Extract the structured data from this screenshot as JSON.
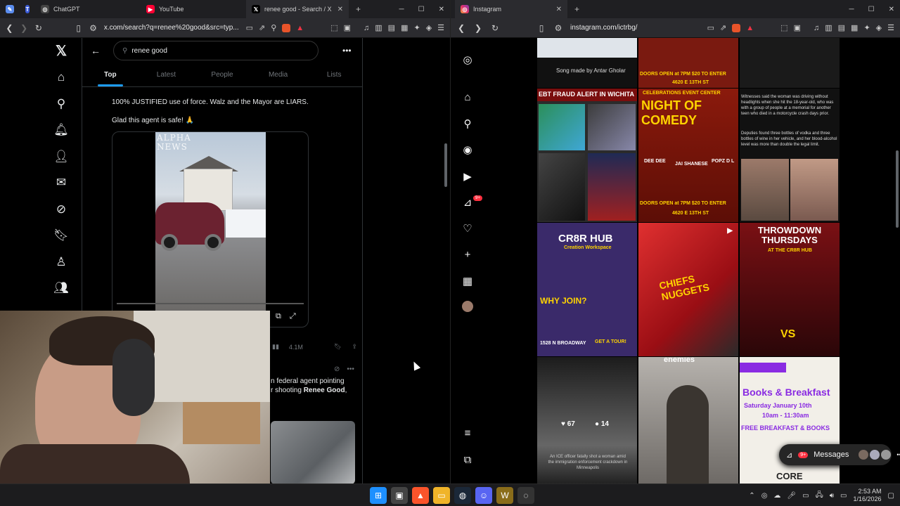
{
  "left_browser": {
    "tabs": [
      {
        "title": "ChatGPT",
        "active": false
      },
      {
        "title": "YouTube",
        "active": false
      },
      {
        "title": "renee good - Search / X",
        "active": true
      }
    ],
    "url": "x.com/search?q=renee%20good&src=typ..."
  },
  "x": {
    "search_value": "renee good",
    "tabs": [
      "Top",
      "Latest",
      "People",
      "Media",
      "Lists"
    ],
    "active_tab": "Top",
    "tweet1": {
      "text": "100% JUSTIFIED use of force. Walz and the Mayor are LIARS.",
      "text2": "Glad this agent is safe! 🙏",
      "watermark": "ALPHA\nNEWS",
      "views": "4.1M"
    },
    "tweet2": {
      "text_before": "n federal agent pointing",
      "text_line2_before": "r shooting ",
      "text_bold": "Renee Good",
      "text_after": ","
    }
  },
  "right_browser": {
    "tabs": [
      {
        "title": "Instagram",
        "active": true
      }
    ],
    "url": "instagram.com/ictrbg/"
  },
  "instagram": {
    "nav_badge": "9+",
    "posts": {
      "song": "Song made by Antar Gholar",
      "ebt": "EBT FRAUD ALERT IN WICHITA",
      "comedy_top": "CELEBRATIONS EVENT CENTER",
      "comedy_title": "NIGHT OF COMEDY",
      "comedy_names": [
        "DEE DEE",
        "JAI SHANESE",
        "POPZ D L"
      ],
      "comedy_doors": "DOORS OPEN at 7PM $20 TO ENTER",
      "comedy_addr": "4620 E 13TH ST",
      "news_text1": "Witnesses said the woman was driving without headlights when she hit the 18-year-old, who was with a group of people at a memorial for another teen who died in a motorcycle crash days prior.",
      "news_text2": "Deputies found three bottles of vodka and three bottles of wine in her vehicle, and her blood-alcohol level was more than double the legal limit.",
      "cr8r_title": "CR8R HUB",
      "cr8r_sub": "Creation Workspace",
      "cr8r_why": "WHY JOIN?",
      "cr8r_addr": "1528 N BROADWAY",
      "cr8r_tour": "GET A TOUR!",
      "chiefs": "CHIEFS NUGGETS",
      "throwdown_title": "THROWDOWN THURSDAYS",
      "throwdown_sub": "AT THE CR8R HUB",
      "throwdown_vs": "VS",
      "ice_likes": "67",
      "ice_comments": "14",
      "ice_caption": "An ICE officer fatally shot a woman amid the immigration enforcement crackdown in Minneapolis",
      "enemies": "enemies",
      "books_title": "Books & Breakfast",
      "books_date": "Saturday January 10th",
      "books_time": "10am - 11:30am",
      "books_free": "FREE BREAKFAST & BOOKS",
      "core": "CORE"
    },
    "messages_label": "Messages",
    "messages_badge": "9+"
  },
  "taskbar": {
    "time": "2:53 AM",
    "date": "1/16/2026"
  },
  "colors": {
    "x_accent": "#1d9bf0",
    "ig_badge": "#ff3040"
  }
}
